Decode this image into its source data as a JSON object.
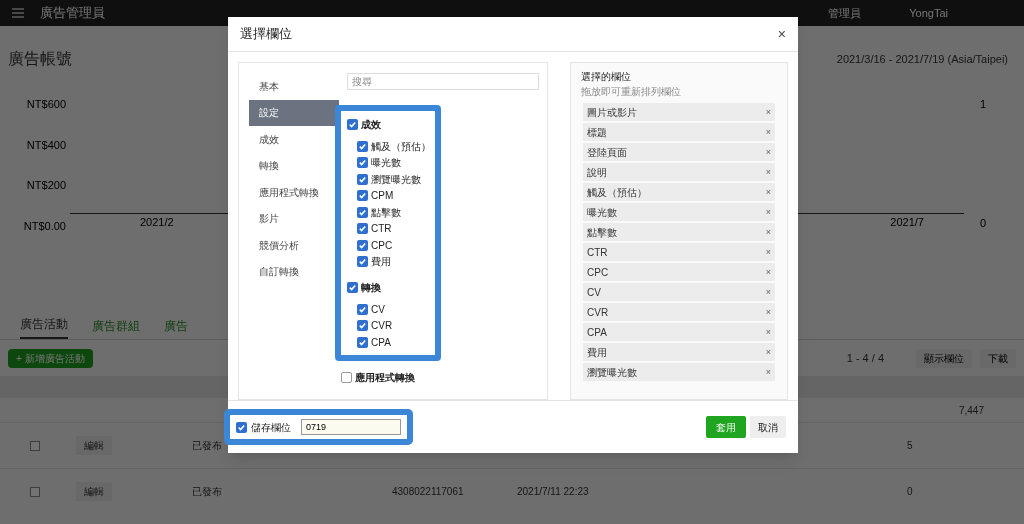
{
  "top_bar": {
    "title": "廣告管理員",
    "role": "管理員",
    "account": "YongTai"
  },
  "header": {
    "title": "廣告帳號",
    "date_range": "2021/3/16 - 2021/7/19 (Asia/Taipei)"
  },
  "chart": {
    "y_labels": [
      "NT$600",
      "NT$400",
      "NT$200",
      "NT$0.00"
    ],
    "x_labels": [
      "2021/2",
      "2021/7"
    ],
    "right_labels": [
      "1",
      "0"
    ]
  },
  "tabs": [
    {
      "label": "廣告活動",
      "selected": true
    },
    {
      "label": "廣告群組",
      "selected": false
    },
    {
      "label": "廣告",
      "selected": false
    }
  ],
  "toolbar": {
    "create": "+ 新增廣告活動",
    "pagination": "1 - 4 / 4",
    "columns": "顯示欄位",
    "download": "下載"
  },
  "table": {
    "total": "7,447",
    "rows": [
      {
        "checked": false,
        "edit": "編輯",
        "status": "已發布",
        "id": "",
        "date": "",
        "count": "5"
      },
      {
        "checked": false,
        "edit": "編輯",
        "status": "已發布",
        "id": "4308022117061",
        "date": "2021/7/11 22:23",
        "count": "0"
      }
    ]
  },
  "dialog": {
    "title": "選擇欄位",
    "close": "×",
    "nav": [
      {
        "label": "基本",
        "selected": false
      },
      {
        "label": "設定",
        "selected": true
      },
      {
        "label": "成效",
        "selected": false
      },
      {
        "label": "轉換",
        "selected": false
      },
      {
        "label": "應用程式轉換",
        "selected": false
      },
      {
        "label": "影片",
        "selected": false
      },
      {
        "label": "競價分析",
        "selected": false
      },
      {
        "label": "自訂轉換",
        "selected": false
      }
    ],
    "search": {
      "placeholder": "搜尋"
    },
    "sections": [
      {
        "highlighted": true,
        "groups": [
          {
            "label": "成效",
            "checked": true,
            "items": [
              {
                "label": "觸及（預估）",
                "checked": true
              },
              {
                "label": "曝光數",
                "checked": true
              },
              {
                "label": "瀏覽曝光數",
                "checked": true
              },
              {
                "label": "CPM",
                "checked": true
              },
              {
                "label": "點擊數",
                "checked": true
              },
              {
                "label": "CTR",
                "checked": true
              },
              {
                "label": "CPC",
                "checked": true
              },
              {
                "label": "費用",
                "checked": true
              }
            ]
          },
          {
            "label": "轉換",
            "checked": true,
            "items": [
              {
                "label": "CV",
                "checked": true
              },
              {
                "label": "CVR",
                "checked": true
              },
              {
                "label": "CPA",
                "checked": true
              }
            ]
          }
        ]
      },
      {
        "highlighted": false,
        "groups": [
          {
            "label": "應用程式轉換",
            "checked": false
          }
        ]
      }
    ],
    "selected_panel": {
      "title": "選擇的欄位",
      "hint": "拖放即可重新排列欄位",
      "remove": "×",
      "fields": [
        "圖片或影片",
        "標題",
        "登陸頁面",
        "說明",
        "觸及（預估）",
        "曝光數",
        "點擊數",
        "CTR",
        "CPC",
        "CV",
        "CVR",
        "CPA",
        "費用",
        "瀏覽曝光數"
      ]
    },
    "save": {
      "label": "儲存欄位",
      "checked": true,
      "highlighted": true,
      "value": "0719"
    },
    "apply": "套用",
    "cancel": "取消"
  }
}
